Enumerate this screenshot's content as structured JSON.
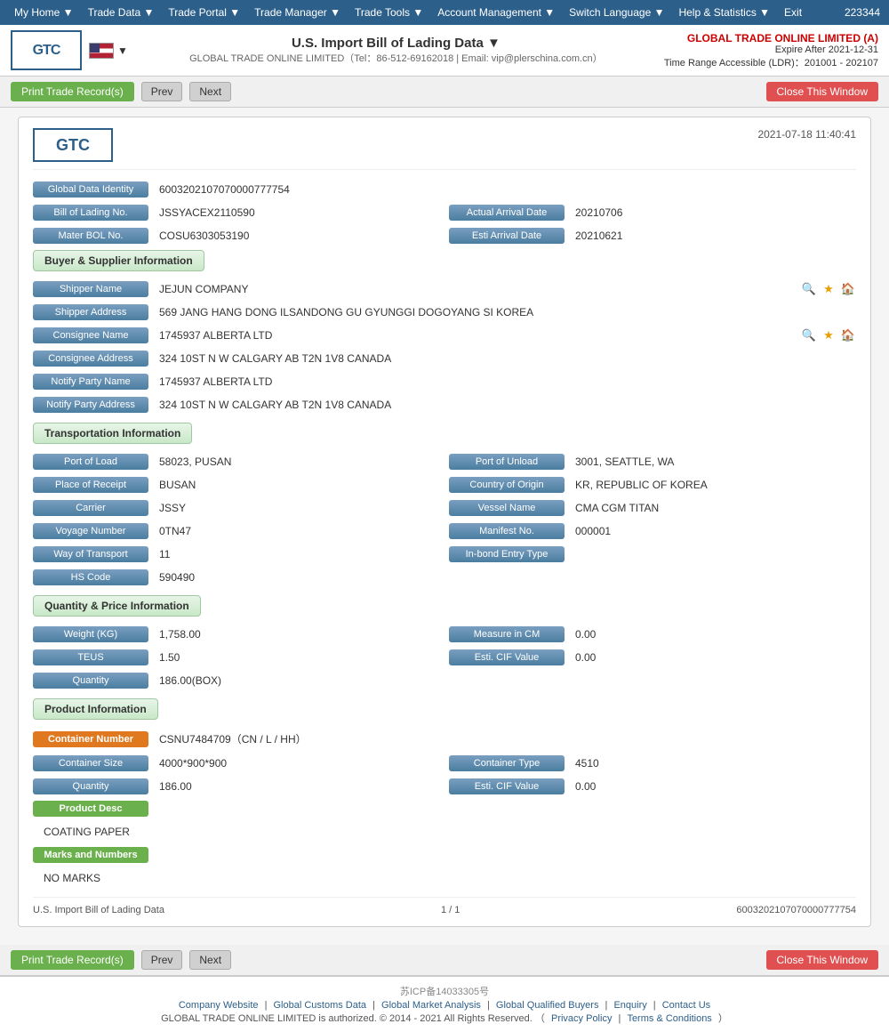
{
  "nav": {
    "user_id": "223344",
    "items": [
      {
        "label": "My Home ▼",
        "key": "my-home"
      },
      {
        "label": "Trade Data ▼",
        "key": "trade-data"
      },
      {
        "label": "Trade Portal ▼",
        "key": "trade-portal"
      },
      {
        "label": "Trade Manager ▼",
        "key": "trade-manager"
      },
      {
        "label": "Trade Tools ▼",
        "key": "trade-tools"
      },
      {
        "label": "Account Management ▼",
        "key": "account-management"
      },
      {
        "label": "Switch Language ▼",
        "key": "switch-language"
      },
      {
        "label": "Help & Statistics ▼",
        "key": "help-statistics"
      },
      {
        "label": "Exit",
        "key": "exit"
      }
    ]
  },
  "header": {
    "logo_text": "GTC",
    "title": "U.S. Import Bill of Lading Data ▼",
    "subtitle": "GLOBAL TRADE ONLINE LIMITED（Tel：86-512-69162018  | Email: vip@plerschina.com.cn）",
    "company": "GLOBAL TRADE ONLINE LIMITED (A)",
    "expire": "Expire After 2021-12-31",
    "time_range": "Time Range Accessible (LDR)：201001 - 202107"
  },
  "toolbar": {
    "print_label": "Print Trade Record(s)",
    "prev_label": "Prev",
    "next_label": "Next",
    "close_label": "Close This Window"
  },
  "record": {
    "datetime": "2021-07-18 11:40:41",
    "global_data_identity": "6003202107070000777754",
    "bill_of_lading_no": "JSSYACEX2110590",
    "actual_arrival_date": "20210706",
    "mater_bol_no": "COSU6303053190",
    "esti_arrival_date": "20210621",
    "buyer_supplier": {
      "shipper_name": "JEJUN COMPANY",
      "shipper_address": "569 JANG HANG DONG ILSANDONG GU GYUNGGI DOGOYANG SI KOREA",
      "consignee_name": "1745937 ALBERTA LTD",
      "consignee_address": "324 10ST N W CALGARY AB T2N 1V8 CANADA",
      "notify_party_name": "1745937 ALBERTA LTD",
      "notify_party_address": "324 10ST N W CALGARY AB T2N 1V8 CANADA"
    },
    "transportation": {
      "port_of_load": "58023, PUSAN",
      "port_of_unload": "3001, SEATTLE, WA",
      "place_of_receipt": "BUSAN",
      "country_of_origin": "KR, REPUBLIC OF KOREA",
      "carrier": "JSSY",
      "vessel_name": "CMA CGM TITAN",
      "voyage_number": "0TN47",
      "manifest_no": "000001",
      "way_of_transport": "11",
      "in_bond_entry_type": "",
      "hs_code": "590490"
    },
    "quantity_price": {
      "weight_kg": "1,758.00",
      "measure_in_cm": "0.00",
      "teus": "1.50",
      "esti_cif_value": "0.00",
      "quantity": "186.00(BOX)"
    },
    "product": {
      "container_number": "CSNU7484709（CN / L / HH）",
      "container_size": "4000*900*900",
      "container_type": "4510",
      "quantity": "186.00",
      "esti_cif_value": "0.00",
      "product_desc": "COATING PAPER",
      "marks_and_numbers": "NO MARKS"
    },
    "footer": {
      "label": "U.S. Import Bill of Lading Data",
      "page": "1 / 1",
      "record_id": "6003202107070000777754"
    }
  },
  "labels": {
    "global_data_identity": "Global Data Identity",
    "bill_of_lading_no": "Bill of Lading No.",
    "actual_arrival_date": "Actual Arrival Date",
    "mater_bol_no": "Mater BOL No.",
    "esti_arrival_date": "Esti Arrival Date",
    "section_buyer": "Buyer & Supplier Information",
    "shipper_name": "Shipper Name",
    "shipper_address": "Shipper Address",
    "consignee_name": "Consignee Name",
    "consignee_address": "Consignee Address",
    "notify_party_name": "Notify Party Name",
    "notify_party_address": "Notify Party Address",
    "section_transport": "Transportation Information",
    "port_of_load": "Port of Load",
    "port_of_unload": "Port of Unload",
    "place_of_receipt": "Place of Receipt",
    "country_of_origin": "Country of Origin",
    "carrier": "Carrier",
    "vessel_name": "Vessel Name",
    "voyage_number": "Voyage Number",
    "manifest_no": "Manifest No.",
    "way_of_transport": "Way of Transport",
    "in_bond_entry_type": "In-bond Entry Type",
    "hs_code": "HS Code",
    "section_quantity": "Quantity & Price Information",
    "weight_kg": "Weight (KG)",
    "measure_in_cm": "Measure in CM",
    "teus": "TEUS",
    "esti_cif_value": "Esti. CIF Value",
    "quantity": "Quantity",
    "section_product": "Product Information",
    "container_number": "Container Number",
    "container_size": "Container Size",
    "container_type": "Container Type",
    "esti_cif_value2": "Esti. CIF Value",
    "quantity2": "Quantity",
    "product_desc": "Product Desc",
    "marks_and_numbers": "Marks and Numbers"
  },
  "footer_links": {
    "icp": "苏ICP备14033305号",
    "links": [
      "Company Website",
      "Global Customs Data",
      "Global Market Analysis",
      "Global Qualified Buyers",
      "Enquiry",
      "Contact Us"
    ],
    "copyright": "GLOBAL TRADE ONLINE LIMITED is authorized. © 2014 - 2021 All Rights Reserved.",
    "privacy": "Privacy Policy",
    "terms": "Terms & Conditions"
  }
}
